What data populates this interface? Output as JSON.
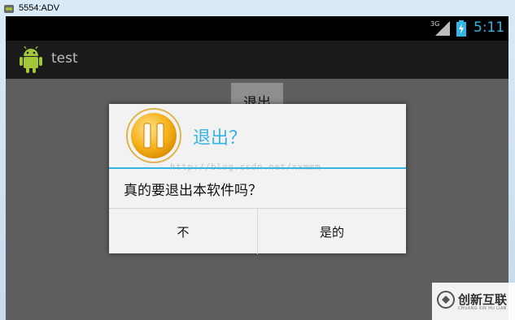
{
  "window": {
    "title": "5554:ADV"
  },
  "status_bar": {
    "network": "3G",
    "time": "5:11",
    "accent_color": "#33b5e5"
  },
  "action_bar": {
    "app_title": "test",
    "app_icon": "android-icon"
  },
  "content": {
    "exit_button_label": "退出"
  },
  "dialog": {
    "title": "退出？",
    "icon": "pause-icon",
    "message": "真的要退出本软件吗？",
    "watermark_url": "http://blog.csdn.net/xxmmm",
    "buttons": {
      "negative_label": "不",
      "positive_label": "是的"
    }
  },
  "corner_watermark": {
    "text": "创新互联",
    "subtext": "CHUANG XIN HU LIAN"
  }
}
